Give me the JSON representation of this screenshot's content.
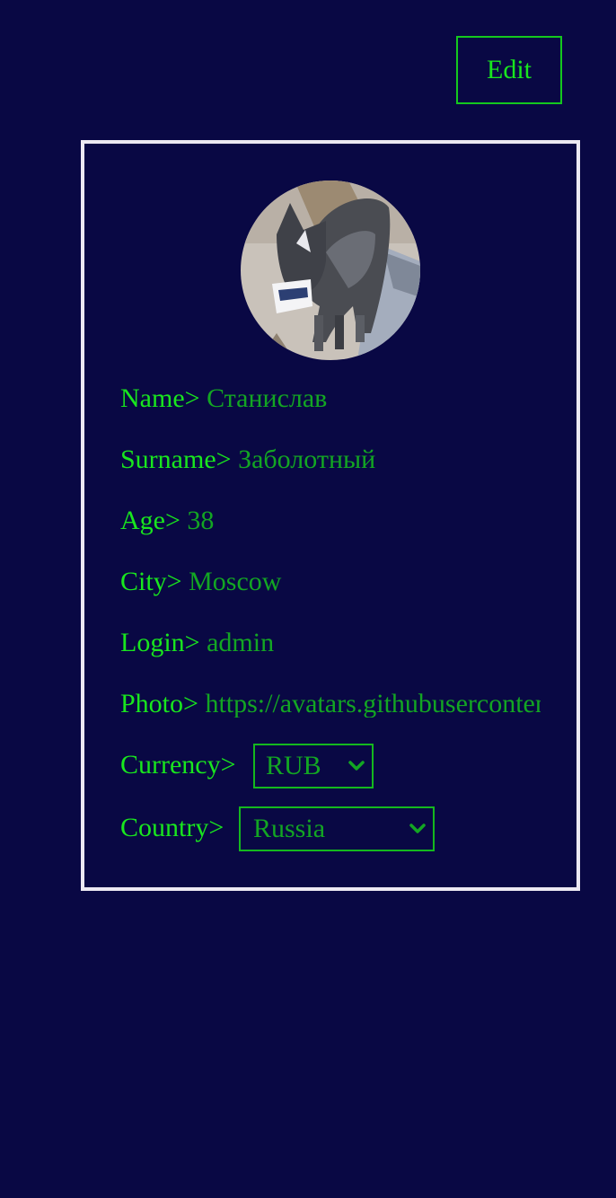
{
  "header": {
    "edit_label": "Edit"
  },
  "profile": {
    "name_label": "Name>",
    "name_value": "Станислав",
    "surname_label": "Surname>",
    "surname_value": "Заболотный",
    "age_label": "Age>",
    "age_value": "38",
    "city_label": "City>",
    "city_value": "Moscow",
    "login_label": "Login>",
    "login_value": "admin",
    "photo_label": "Photo>",
    "photo_value": "https://avatars.githubusercontent.com",
    "currency_label": "Currency>",
    "currency_value": "RUB",
    "country_label": "Country>",
    "country_value": "Russia"
  },
  "colors": {
    "background": "#090844",
    "label_green": "#19e61e",
    "value_green": "#13a623",
    "card_border": "#ece9f2"
  },
  "icons": {
    "avatar": "dog-photo-avatar",
    "select_arrow": "chevron-down-icon"
  }
}
